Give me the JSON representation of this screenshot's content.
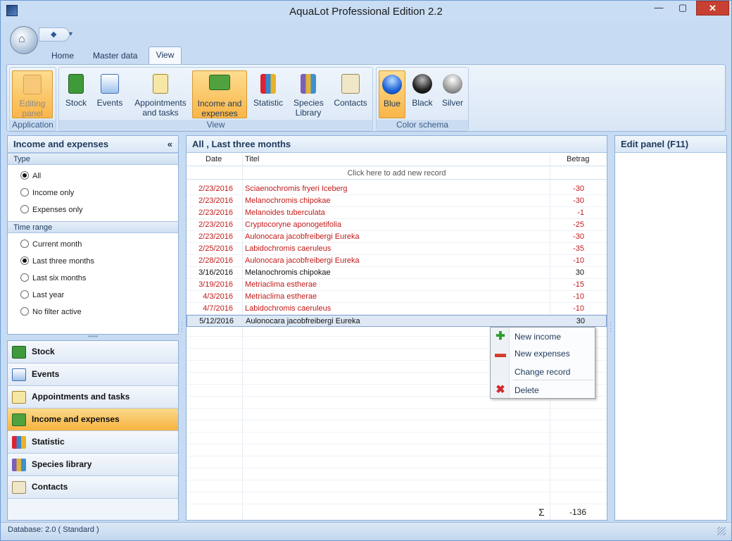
{
  "window": {
    "title": "AquaLot Professional Edition 2.2",
    "min": "—",
    "max": "▢",
    "close": "✕"
  },
  "qat": {
    "dropdown": "▾"
  },
  "ribbon": {
    "tabs": [
      "Home",
      "Master data",
      "View"
    ],
    "groups": {
      "application": {
        "label": "Application",
        "editing_panel": "Editing panel"
      },
      "view": {
        "label": "View",
        "stock": "Stock",
        "events": "Events",
        "appointments": "Appointments and tasks",
        "income": "Income and expenses",
        "statistic": "Statistic",
        "species": "Species Library",
        "contacts": "Contacts"
      },
      "color_schema": {
        "label": "Color schema",
        "blue": "Blue",
        "black": "Black",
        "silver": "Silver"
      }
    }
  },
  "left_panel": {
    "title": "Income and expenses",
    "collapse": "«",
    "type_label": "Type",
    "type_options": [
      "All",
      "Income only",
      "Expenses only"
    ],
    "type_selected": "All",
    "time_label": "Time range",
    "time_options": [
      "Current month",
      "Last three months",
      "Last six months",
      "Last year",
      "No filter active"
    ],
    "time_selected": "Last three months"
  },
  "nav": {
    "items": [
      "Stock",
      "Events",
      "Appointments and tasks",
      "Income and expenses",
      "Statistic",
      "Species library",
      "Contacts"
    ],
    "selected": "Income and expenses"
  },
  "grid": {
    "title": "All , Last three months",
    "columns": {
      "date": "Date",
      "title": "Titel",
      "amount": "Betrag"
    },
    "new_record": "Click here to add new record",
    "rows": [
      {
        "date": "2/23/2016",
        "title": "Sciaenochromis fryeri Iceberg",
        "amount": "-30"
      },
      {
        "date": "2/23/2016",
        "title": "Melanochromis chipokae",
        "amount": "-30"
      },
      {
        "date": "2/23/2016",
        "title": "Melanoides tuberculata",
        "amount": "-1"
      },
      {
        "date": "2/23/2016",
        "title": "Cryptocoryne aponogetifolia",
        "amount": "-25"
      },
      {
        "date": "2/23/2016",
        "title": "Aulonocara jacobfreibergi Eureka",
        "amount": "-30"
      },
      {
        "date": "2/25/2016",
        "title": "Labidochromis caeruleus",
        "amount": "-35"
      },
      {
        "date": "2/28/2016",
        "title": "Aulonocara jacobfreibergi Eureka",
        "amount": "-10"
      },
      {
        "date": "3/16/2016",
        "title": "Melanochromis chipokae",
        "amount": "30"
      },
      {
        "date": "3/19/2016",
        "title": "Metriaclima estherae",
        "amount": "-15"
      },
      {
        "date": "4/3/2016",
        "title": "Metriaclima estherae",
        "amount": "-10"
      },
      {
        "date": "4/7/2016",
        "title": "Labidochromis caeruleus",
        "amount": "-10"
      },
      {
        "date": "5/12/2016",
        "title": "Aulonocara jacobfreibergi Eureka",
        "amount": "30"
      }
    ],
    "selected_row": 11,
    "sum_symbol": "Σ",
    "sum": "-136",
    "colors": {
      "negative": "#c21a1a",
      "positive": "#111111"
    }
  },
  "context_menu": {
    "items": [
      "New income",
      "New expenses",
      "Change record",
      "Delete"
    ],
    "icons": [
      "plus-icon",
      "minus-icon",
      "",
      "delete-x-icon"
    ]
  },
  "edit_panel": {
    "title": "Edit panel (F11)"
  },
  "status": {
    "text": "Database: 2.0 ( Standard )"
  }
}
